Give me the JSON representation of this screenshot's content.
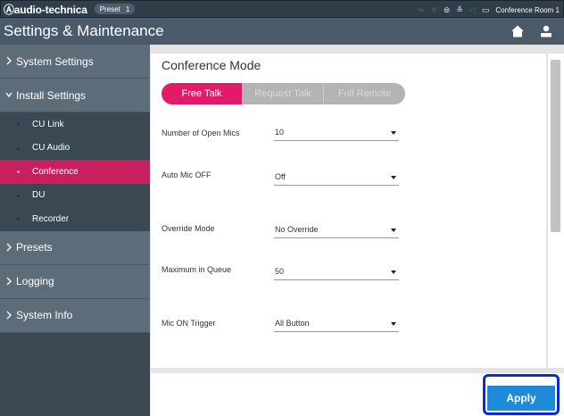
{
  "topbar": {
    "brand": "Ⓐaudio-technica",
    "preset_label": "Preset",
    "preset_number": "1",
    "room_name": "Conference Room 1",
    "icons": [
      "network-icon",
      "signal-icon",
      "camera-icon",
      "recording-icon",
      "speaker-icon",
      "display-icon"
    ]
  },
  "titlebar": {
    "title": "Settings & Maintenance",
    "icons": [
      "home-icon",
      "user-icon"
    ]
  },
  "sidebar": {
    "system_settings": "System Settings",
    "install_settings": "Install Settings",
    "sub_items": [
      "CU Link",
      "CU Audio",
      "Conference",
      "DU",
      "Recorder"
    ],
    "active_sub_item": "Conference",
    "presets": "Presets",
    "logging": "Logging",
    "system_info": "System Info"
  },
  "main": {
    "title": "Conference Mode",
    "modes": [
      "Free Talk",
      "Request Talk",
      "Full Remote"
    ],
    "selected_mode": "Free Talk",
    "fields": [
      {
        "label": "Number of Open Mics",
        "value": "10"
      },
      {
        "label": "Auto Mic OFF",
        "value": "Off"
      },
      {
        "label": "Override Mode",
        "value": "No Override"
      },
      {
        "label": "Maximum in Queue",
        "value": "50"
      },
      {
        "label": "Mic ON Trigger",
        "value": "All Button"
      }
    ]
  },
  "footer": {
    "apply_label": "Apply"
  },
  "colors": {
    "topbar": "#2f3e4a",
    "titlebar": "#4a5a68",
    "sidebar_main": "#5c6c79",
    "sidebar_sub": "#3a4853",
    "accent_pink": "#e21a68",
    "active_sub": "#c8205f",
    "apply_blue": "#1f8ad8",
    "highlight_outline": "#0a2bd6"
  }
}
